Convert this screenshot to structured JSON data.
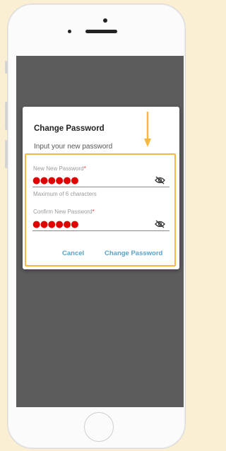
{
  "dialog": {
    "title": "Change Password",
    "subtitle": "Input your new password",
    "new_password": {
      "label": "New New Password",
      "required_mark": "*",
      "value": "●●●●●●",
      "hint": "Maximum of 6 characters",
      "visibility_icon": "eye-off-icon"
    },
    "confirm_password": {
      "label": "Confirm New Password",
      "required_mark": "*",
      "value": "●●●●●●",
      "visibility_icon": "eye-off-icon"
    },
    "actions": {
      "cancel_label": "Cancel",
      "confirm_label": "Change Password"
    }
  },
  "annotation": {
    "arrow_icon": "arrow-down-icon",
    "highlight_color": "#f5b942"
  },
  "colors": {
    "background": "#fbefd3",
    "overlay": "#5c5c5c",
    "accent": "#5aa2c6",
    "password_dots": "#e00000",
    "required": "#e53935"
  }
}
